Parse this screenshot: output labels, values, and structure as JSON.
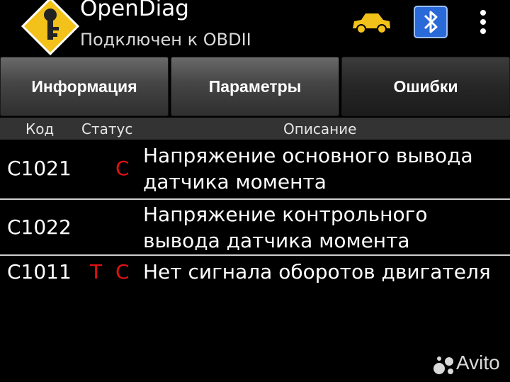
{
  "app": {
    "title": "OpenDiag",
    "subtitle": "Подключен к OBDII",
    "logo_icon": "key-diamond-icon",
    "status_icons": [
      "car-icon",
      "bluetooth-icon"
    ],
    "menu_icon": "overflow-menu-icon",
    "colors": {
      "logo": "#f2c21b",
      "car": "#f2c21b",
      "bluetooth": "#2a6ad8",
      "flag": "#e01010"
    }
  },
  "tabs": [
    {
      "label": "Информация",
      "active": false
    },
    {
      "label": "Параметры",
      "active": false
    },
    {
      "label": "Ошибки",
      "active": true
    }
  ],
  "table": {
    "headers": {
      "code": "Код",
      "status": "Статус",
      "description": "Описание"
    },
    "rows": [
      {
        "code": "C1021",
        "flag_t": "",
        "flag_c": "C",
        "description": "Напряжение основного вывода датчика момента"
      },
      {
        "code": "C1022",
        "flag_t": "",
        "flag_c": "",
        "description": "Напряжение контрольного вывода датчика момента"
      },
      {
        "code": "C1011",
        "flag_t": "T",
        "flag_c": "C",
        "description": "Нет сигнала оборотов двигателя"
      }
    ]
  },
  "watermark": {
    "text": "Avito"
  }
}
